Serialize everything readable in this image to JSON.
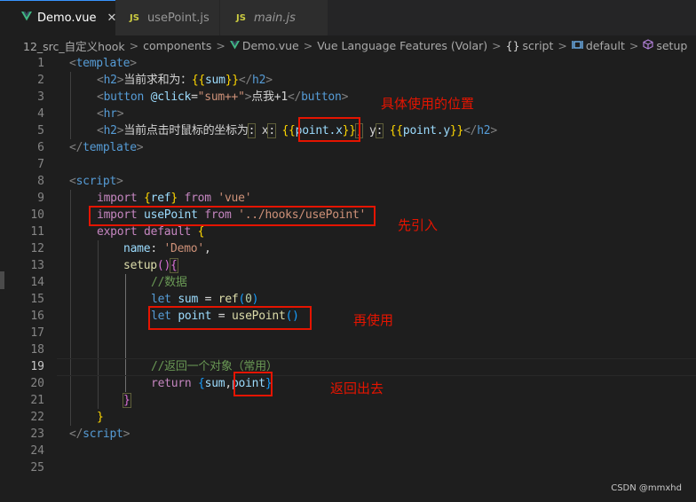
{
  "tabs": [
    {
      "label": "Demo.vue",
      "icon": "vue-icon",
      "active": true,
      "close": "✕"
    },
    {
      "label": "usePoint.js",
      "icon_text": "JS",
      "active": false
    },
    {
      "label": "main.js",
      "icon_text": "JS",
      "active": false,
      "italic": true
    }
  ],
  "breadcrumb": {
    "items": [
      "12_src_自定义hook",
      "components",
      "Demo.vue",
      "Vue Language Features (Volar)",
      "script",
      "default",
      "setup"
    ],
    "separator": ">",
    "script_icon": "{}"
  },
  "editor": {
    "line_numbers": [
      "1",
      "2",
      "3",
      "4",
      "5",
      "6",
      "7",
      "8",
      "9",
      "10",
      "11",
      "12",
      "13",
      "14",
      "15",
      "16",
      "17",
      "18",
      "19",
      "20",
      "21",
      "22",
      "23",
      "24",
      "25"
    ],
    "current_line": "19",
    "lines": {
      "l1": {
        "lt": "<",
        "tag": "template",
        "gt": ">"
      },
      "l2": {
        "lt": "<",
        "tag": "h2",
        "gt": ">",
        "text": "当前求和为：",
        "mo": "{{",
        "var": "sum",
        "mc": "}}",
        "clt": "</",
        "ctag": "h2",
        "cgt": ">"
      },
      "l3": {
        "lt": "<",
        "tag": "button",
        "sp": " ",
        "attr": "@click",
        "eq": "=",
        "str": "\"sum++\"",
        "gt": ">",
        "text": "点我+1",
        "clt": "</",
        "ctag": "button",
        "cgt": ">"
      },
      "l4": {
        "lt": "<",
        "tag": "hr",
        "gt": ">"
      },
      "l5": {
        "lt": "<",
        "tag": "h2",
        "gt": ">",
        "text": "当前点击时鼠标的坐标为",
        "c1": ":",
        "sp1": " ",
        "x": "x",
        "c2": ":",
        "sp2": " ",
        "mo": "{{",
        "var": "point.x",
        "mc": "}}",
        "comma": ",",
        "sp3": " ",
        "y": "y",
        "c3": ":",
        "sp4": " ",
        "mo2": "{{",
        "var2": "point.y",
        "mc2": "}}",
        "clt": "</",
        "ctag": "h2",
        "cgt": ">"
      },
      "l6": {
        "lt": "</",
        "tag": "template",
        "gt": ">"
      },
      "l8": {
        "lt": "<",
        "tag": "script",
        "gt": ">"
      },
      "l9": {
        "kw": "import",
        "sp": " ",
        "b1": "{",
        "var": "ref",
        "b2": "}",
        "sp2": " ",
        "from": "from",
        "sp3": " ",
        "str": "'vue'"
      },
      "l10": {
        "kw": "import",
        "sp": " ",
        "var": "usePoint",
        "sp2": " ",
        "from": "from",
        "sp3": " ",
        "str": "'../hooks/usePoint'"
      },
      "l11": {
        "kw": "export",
        "sp": " ",
        "kw2": "default",
        "sp2": " ",
        "b": "{"
      },
      "l12": {
        "prop": "name",
        "colon": ":",
        "sp": " ",
        "str": "'Demo'",
        "comma": ","
      },
      "l13": {
        "fn": "setup",
        "p1": "(",
        "p2": ")",
        "b": "{"
      },
      "l14": {
        "cm": "//数据"
      },
      "l15": {
        "kw": "let",
        "sp": " ",
        "var": "sum",
        "op": " = ",
        "fn": "ref",
        "p1": "(",
        "num": "0",
        "p2": ")"
      },
      "l16": {
        "kw": "let",
        "sp": " ",
        "var": "point",
        "op": " = ",
        "fn": "usePoint",
        "p1": "(",
        "p2": ")"
      },
      "l19": {
        "cm": "//返回一个对象（常用）"
      },
      "l20": {
        "kw": "return",
        "sp": " ",
        "b1": "{",
        "v1": "sum",
        "comma": ",",
        "v2": "point",
        "b2": "}"
      },
      "l21": {
        "b": "}"
      },
      "l22": {
        "b": "}"
      },
      "l23": {
        "lt": "</",
        "tag": "script",
        "gt": ">"
      }
    }
  },
  "annotations": {
    "a1": "具体使用的位置",
    "a2": "先引入",
    "a3": "再使用",
    "a4": "返回出去"
  },
  "watermark": "CSDN @mmxhd",
  "colors": {
    "annotation": "#e51400",
    "tab_accent": "#3794ff",
    "vue_green": "#41b883",
    "js_yellow": "#cbcb41"
  }
}
